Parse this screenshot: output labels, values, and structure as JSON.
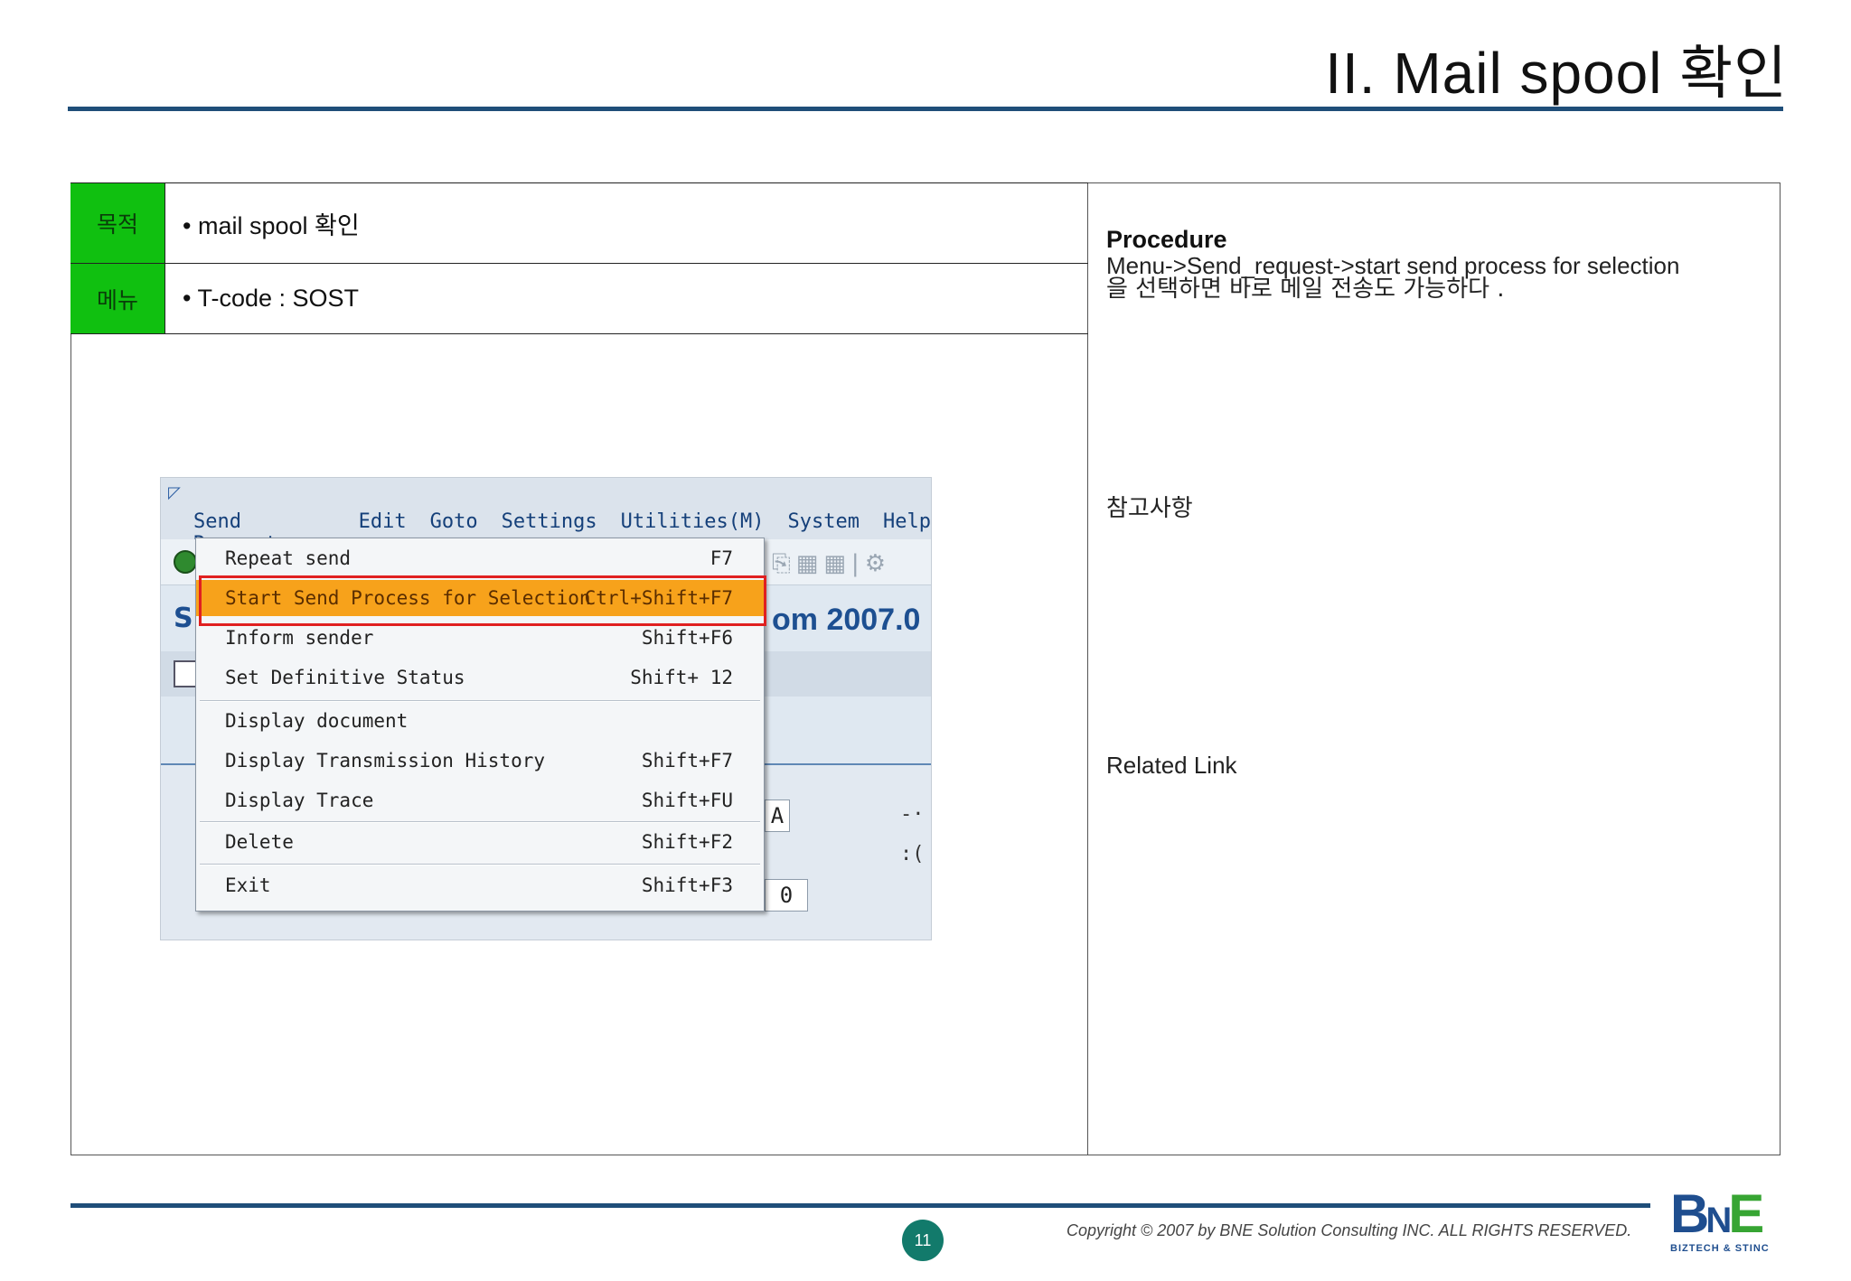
{
  "title": "II. Mail spool  확인",
  "info": {
    "purpose_label": "목적",
    "purpose_value": "• mail spool 확인",
    "menu_label": "메뉴",
    "menu_value": "• T-code : SOST"
  },
  "side": {
    "procedure_title": "Procedure",
    "procedure_line1": "Menu->Send_request->start send process for selection",
    "procedure_line2": "을 선택하면 바로 메일 전송도 가능하다 .",
    "reference_label": "참고사항",
    "related_link_label": "Related Link"
  },
  "sap": {
    "menubar": [
      "Send Request",
      "Edit",
      "Goto",
      "Settings",
      "Utilities(M)",
      "System",
      "Help"
    ],
    "title_fragment": "om 2007.0",
    "title_initial": "S",
    "field_a": "A",
    "field_zero": "0",
    "menu_items": [
      {
        "label": "Repeat send",
        "shortcut": "F7"
      },
      {
        "label": "Start Send Process for Selection",
        "shortcut": "Ctrl+Shift+F7"
      },
      {
        "label": "Inform sender",
        "shortcut": "Shift+F6"
      },
      {
        "label": "Set Definitive Status",
        "shortcut": "Shift+ 12"
      },
      {
        "label": "Display document",
        "shortcut": ""
      },
      {
        "label": "Display Transmission History",
        "shortcut": "Shift+F7"
      },
      {
        "label": "Display Trace",
        "shortcut": "Shift+FU"
      },
      {
        "label": "Delete",
        "shortcut": "Shift+F2"
      },
      {
        "label": "Exit",
        "shortcut": "Shift+F3"
      }
    ]
  },
  "footer": {
    "page_number": "11",
    "copyright": "Copyright © 2007 by BNE Solution Consulting INC.   ALL RIGHTS RESERVED.",
    "logo_b": "B",
    "logo_n": "N",
    "logo_e": "E",
    "logo_sub": "BIZTECH & STINC"
  },
  "colors": {
    "accent_rule": "#1f4e79",
    "label_green": "#10c010",
    "highlight_orange": "#f7a21b",
    "highlight_border": "#e02020",
    "page_badge": "#127a6b"
  }
}
